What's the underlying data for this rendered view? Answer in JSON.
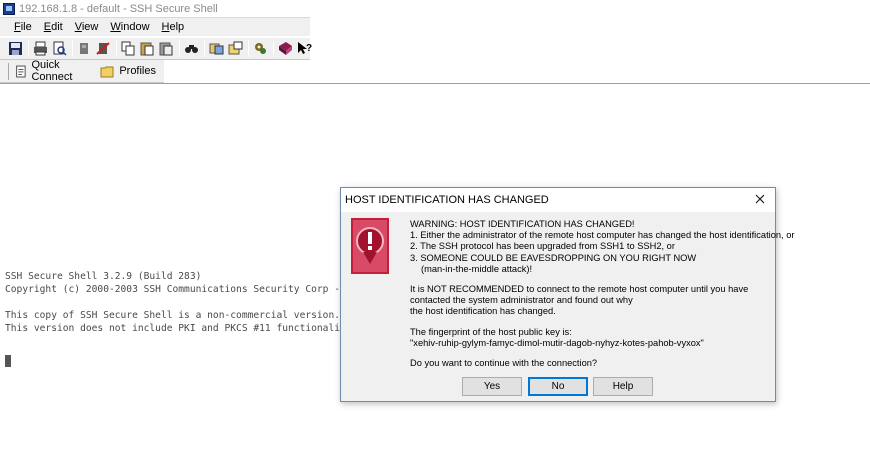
{
  "window": {
    "title": "192.168.1.8 - default - SSH Secure Shell"
  },
  "menu": [
    "File",
    "Edit",
    "View",
    "Window",
    "Help"
  ],
  "toolbar_icons": [
    "save-icon",
    "print-icon",
    "print-preview-icon",
    "disconnect-icon",
    "reconnect-icon",
    "copy-icon",
    "paste-icon",
    "paste-selection-icon",
    "find-icon",
    "file-transfer-icon",
    "new-terminal-icon",
    "settings-icon",
    "help-book-icon",
    "context-help-icon"
  ],
  "linkbar": {
    "quick_connect": "Quick Connect",
    "profiles": "Profiles"
  },
  "terminal": {
    "line1": "SSH Secure Shell 3.2.9 (Build 283)",
    "line2": "Copyright (c) 2000-2003 SSH Communications Security Corp -",
    "line3": "This copy of SSH Secure Shell is a non-commercial version.",
    "line4": "This version does not include PKI and PKCS #11 functionalit"
  },
  "dialog": {
    "title": "HOST IDENTIFICATION HAS CHANGED",
    "warning": "WARNING: HOST IDENTIFICATION HAS CHANGED!",
    "item1": "1. Either the administrator of the remote host computer has changed the host identification, or",
    "item2": "2. The SSH protocol has been upgraded from SSH1 to SSH2, or",
    "item3": "3. SOMEONE COULD BE EAVESDROPPING ON YOU RIGHT NOW",
    "item3b": "(man-in-the-middle attack)!",
    "rec1": "It is NOT RECOMMENDED to connect to the remote host computer until you have",
    "rec2": "contacted the system administrator and found out why",
    "rec3": "the host identification has changed.",
    "fp_label": "The fingerprint of the host public key is:",
    "fingerprint": "\"xehiv-ruhip-gylym-famyc-dimol-mutir-dagob-nyhyz-kotes-pahob-vyxox\"",
    "question": "Do you want to continue with the connection?",
    "buttons": {
      "yes": "Yes",
      "no": "No",
      "help": "Help"
    }
  },
  "colors": {
    "dialog_border": "#6f8bb0",
    "default_button": "#0078d7",
    "warning_icon": "#c41e3a"
  }
}
